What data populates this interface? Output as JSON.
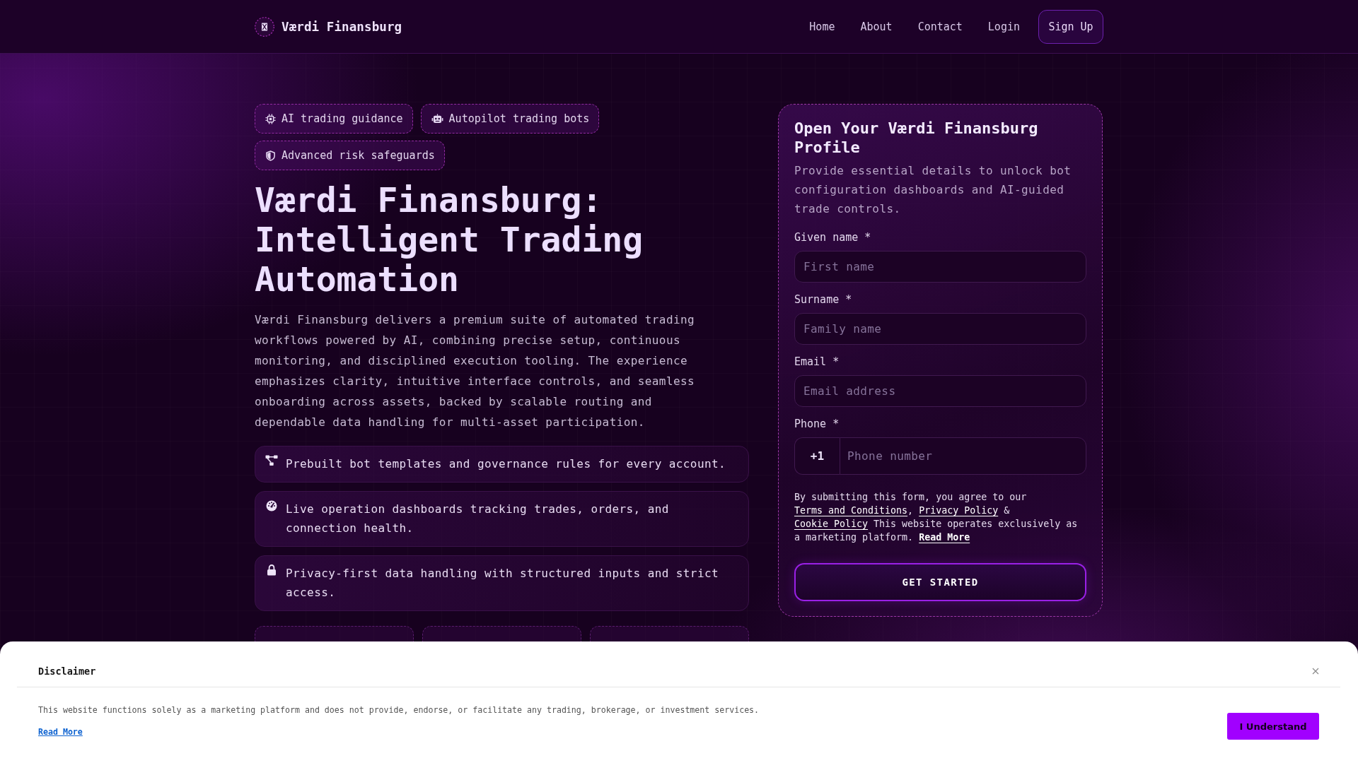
{
  "header": {
    "brand": "Værdi Finansburg",
    "nav": [
      {
        "label": "Home",
        "kind": "link"
      },
      {
        "label": "About",
        "kind": "link"
      },
      {
        "label": "Contact",
        "kind": "link"
      },
      {
        "label": "Login",
        "kind": "link"
      },
      {
        "label": "Sign Up",
        "kind": "button"
      }
    ]
  },
  "hero": {
    "badges": [
      {
        "label": "AI trading guidance"
      },
      {
        "label": "Autopilot trading bots"
      },
      {
        "label": "Advanced risk safeguards"
      }
    ],
    "title": "Værdi Finansburg: Intelligent Trading Automation",
    "description": "Værdi Finansburg delivers a premium suite of automated trading workflows powered by AI, combining precise setup, continuous monitoring, and disciplined execution tooling. The experience emphasizes clarity, intuitive interface controls, and seamless onboarding across assets, backed by scalable routing and dependable data handling for multi-asset participation.",
    "features": [
      {
        "text": "Prebuilt bot templates and governance rules for every account."
      },
      {
        "text": "Live operation dashboards tracking trades, orders, and connection health."
      },
      {
        "text": "Privacy-first data handling with structured inputs and strict access."
      }
    ]
  },
  "signup_form": {
    "title": "Open Your Værdi Finansburg Profile",
    "description": "Provide essential details to unlock bot configuration dashboards and AI-guided trade controls.",
    "fields": [
      {
        "kind": "text",
        "label": "Given name *",
        "placeholder": "First name"
      },
      {
        "kind": "text",
        "label": "Surname *",
        "placeholder": "Family name"
      },
      {
        "kind": "text",
        "label": "Email *",
        "placeholder": "Email address"
      },
      {
        "kind": "phone",
        "label": "Phone *",
        "prefix": "+1",
        "placeholder": "Phone number"
      }
    ],
    "consent": [
      {
        "kind": "text",
        "text": "By submitting this form, you agree to our "
      },
      {
        "kind": "link",
        "text": "Terms and Conditions"
      },
      {
        "kind": "text",
        "text": ", "
      },
      {
        "kind": "link",
        "text": "Privacy Policy"
      },
      {
        "kind": "text",
        "text": " & "
      },
      {
        "kind": "link",
        "text": "Cookie Policy"
      },
      {
        "kind": "text",
        "text": " This website operates exclusively as a marketing platform. "
      },
      {
        "kind": "bold_link",
        "text": "Read More"
      }
    ],
    "submit": "GET STARTED"
  },
  "disclaimer": {
    "title": "Disclaimer",
    "text": "This website functions solely as a marketing platform and does not provide, endorse, or facilitate any trading, brokerage, or investment services.",
    "link": "Read More",
    "button": "I Understand"
  }
}
